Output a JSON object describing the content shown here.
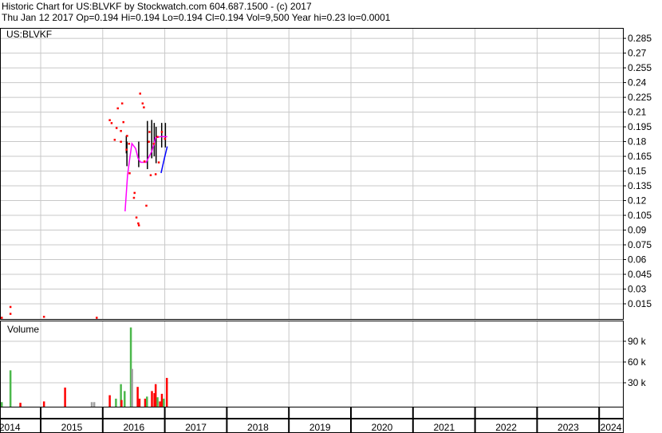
{
  "header": {
    "line1": "Historic Chart for US:BLVKF by Stockwatch.com 604.687.1500 - (c) 2017",
    "line2": "Thu Jan 12 2017   Op=0.194  Hi=0.194  Lo=0.194  Cl=0.194  Vol=9,500   Year hi=0.23  lo=0.0001"
  },
  "chart_data": [
    {
      "type": "scatter",
      "title": "US:BLVKF",
      "ylim": [
        0,
        0.295
      ],
      "xlim": [
        2014,
        2025
      ],
      "yticks": [
        "0.285",
        "0.27",
        "0.255",
        "0.24",
        "0.225",
        "0.21",
        "0.195",
        "0.18",
        "0.165",
        "0.15",
        "0.135",
        "0.12",
        "0.105",
        "0.09",
        "0.075",
        "0.06",
        "0.045",
        "0.03",
        "0.015"
      ],
      "colors": {
        "points": "#ff0000",
        "hilo": "#000000",
        "ma1": "#ff00ff",
        "ma2": "#0000ff",
        "grid": "#c8c8c8"
      },
      "points": [
        [
          2014.51,
          0.012
        ],
        [
          2014.51,
          0.005
        ],
        [
          2014.37,
          0.001
        ],
        [
          2015.05,
          0.002
        ],
        [
          2015.9,
          0.001
        ],
        [
          2016.6,
          0.229
        ],
        [
          2016.31,
          0.219
        ],
        [
          2016.64,
          0.219
        ],
        [
          2016.66,
          0.215
        ],
        [
          2016.24,
          0.214
        ],
        [
          2016.11,
          0.202
        ],
        [
          2016.14,
          0.199
        ],
        [
          2016.22,
          0.194
        ],
        [
          2016.33,
          0.2
        ],
        [
          2016.29,
          0.191
        ],
        [
          2016.19,
          0.182
        ],
        [
          2016.29,
          0.18
        ],
        [
          2016.42,
          0.178
        ],
        [
          2016.38,
          0.172
        ],
        [
          2016.7,
          0.115
        ],
        [
          2016.39,
          0.186
        ],
        [
          2016.43,
          0.148
        ],
        [
          2016.5,
          0.123
        ],
        [
          2016.54,
          0.103
        ],
        [
          2016.57,
          0.097
        ],
        [
          2016.58,
          0.095
        ],
        [
          2016.51,
          0.128
        ],
        [
          2016.77,
          0.146
        ],
        [
          2016.85,
          0.147
        ],
        [
          2016.9,
          0.159
        ],
        [
          2016.75,
          0.19
        ],
        [
          2016.88,
          0.185
        ],
        [
          2016.95,
          0.19
        ],
        [
          2017.0,
          0.183
        ],
        [
          2016.82,
          0.178
        ],
        [
          2016.67,
          0.16
        ],
        [
          2016.74,
          0.18
        ]
      ],
      "hilo": [
        [
          2016.38,
          0.186,
          0.168
        ],
        [
          2016.39,
          0.18,
          0.155
        ],
        [
          2016.58,
          0.18,
          0.154
        ],
        [
          2016.72,
          0.201,
          0.152
        ],
        [
          2016.79,
          0.202,
          0.163
        ],
        [
          2016.83,
          0.199,
          0.165
        ],
        [
          2016.86,
          0.195,
          0.158
        ],
        [
          2016.95,
          0.199,
          0.174
        ],
        [
          2017.01,
          0.199,
          0.174
        ]
      ],
      "ma1": [
        [
          2016.36,
          0.109
        ],
        [
          2016.4,
          0.146
        ],
        [
          2016.44,
          0.165
        ],
        [
          2016.47,
          0.178
        ],
        [
          2016.53,
          0.173
        ],
        [
          2016.57,
          0.163
        ],
        [
          2016.61,
          0.159
        ],
        [
          2016.7,
          0.159
        ],
        [
          2016.79,
          0.17
        ],
        [
          2016.83,
          0.178
        ],
        [
          2016.85,
          0.184
        ],
        [
          2016.93,
          0.185
        ],
        [
          2017.04,
          0.185
        ]
      ],
      "ma2": [
        [
          2016.94,
          0.148
        ],
        [
          2016.99,
          0.162
        ],
        [
          2017.04,
          0.175
        ]
      ]
    },
    {
      "type": "bar",
      "title": "Volume",
      "ylim": [
        0,
        125000
      ],
      "yticks": [
        {
          "v": 90000,
          "label": "90 k"
        },
        {
          "v": 60000,
          "label": "60 k"
        },
        {
          "v": 30000,
          "label": "30 k"
        }
      ],
      "colors": {
        "up": "#4cb84c",
        "down": "#ff0000",
        "flat": "#a0a0a0"
      },
      "bars": [
        [
          2014.37,
          2000,
          "up"
        ],
        [
          2014.51,
          48000,
          "up"
        ],
        [
          2014.67,
          1000,
          "down"
        ],
        [
          2015.05,
          3000,
          "down"
        ],
        [
          2015.39,
          23000,
          "down"
        ],
        [
          2015.82,
          2000,
          "flat"
        ],
        [
          2015.86,
          2000,
          "flat"
        ],
        [
          2016.11,
          12000,
          "down"
        ],
        [
          2016.21,
          7000,
          "up"
        ],
        [
          2016.29,
          28000,
          "up"
        ],
        [
          2016.3,
          5000,
          "down"
        ],
        [
          2016.35,
          18000,
          "up"
        ],
        [
          2016.45,
          110000,
          "up"
        ],
        [
          2016.47,
          50000,
          "flat"
        ],
        [
          2016.56,
          24000,
          "down"
        ],
        [
          2016.59,
          7000,
          "down"
        ],
        [
          2016.68,
          7000,
          "down"
        ],
        [
          2016.71,
          10000,
          "up"
        ],
        [
          2016.79,
          18000,
          "down"
        ],
        [
          2016.83,
          15000,
          "down"
        ],
        [
          2016.85,
          28000,
          "down"
        ],
        [
          2016.88,
          9000,
          "up"
        ],
        [
          2016.92,
          3000,
          "down"
        ],
        [
          2016.95,
          14000,
          "down"
        ],
        [
          2016.98,
          7000,
          "up"
        ],
        [
          2017.03,
          37000,
          "down"
        ]
      ]
    },
    {
      "type": "axis",
      "years": [
        "2014",
        "2015",
        "2016",
        "2017",
        "2018",
        "2019",
        "2020",
        "2021",
        "2022",
        "2023",
        "2024"
      ]
    }
  ]
}
